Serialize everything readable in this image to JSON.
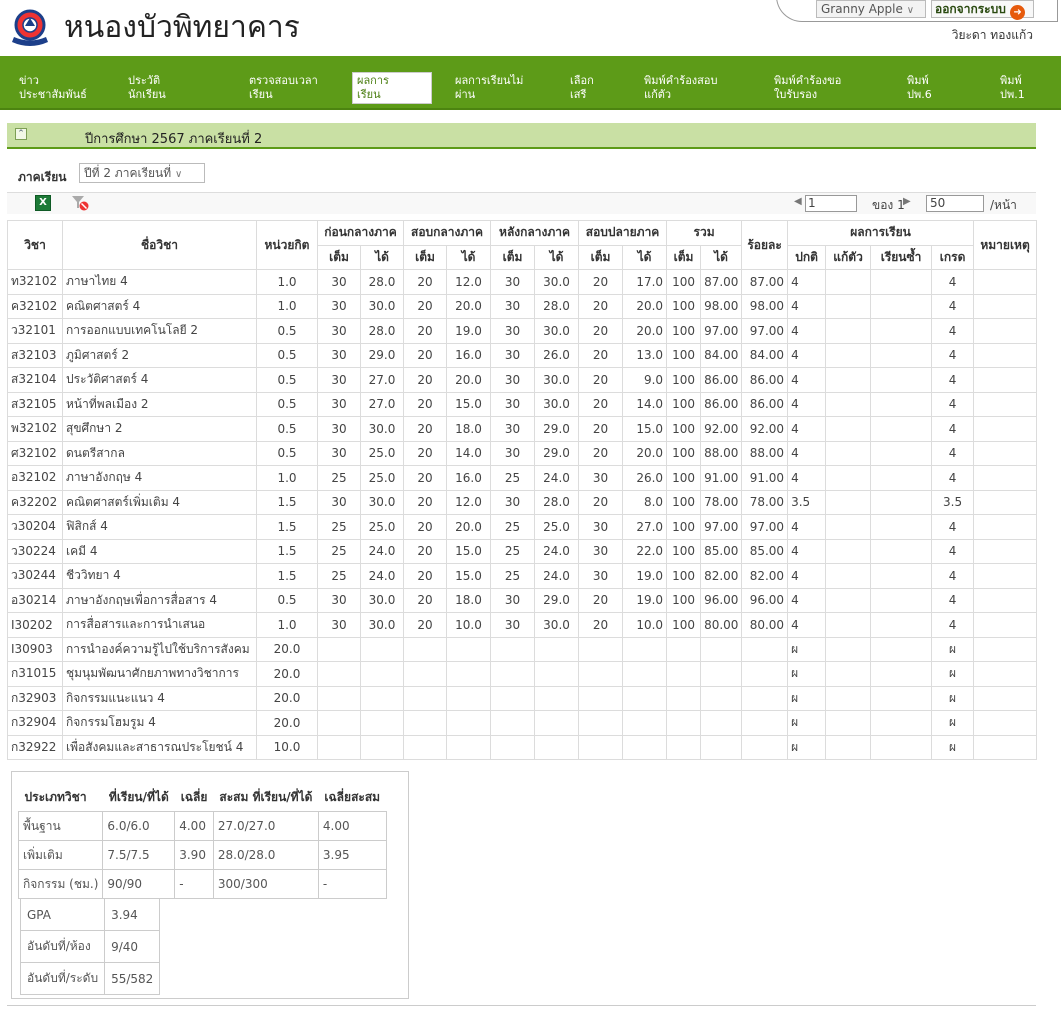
{
  "header": {
    "school_name": "หนองบัวพิทยาคาร",
    "theme_value": "Granny Apple",
    "logout_label": "ออกจากระบบ",
    "user_name": "วิยะดา ทองแก้ว"
  },
  "nav": {
    "items": [
      "ข่าว\nประชาสัมพันธ์",
      "ประวัติ\nนักเรียน",
      "ตรวจสอบเวลา\nเรียน",
      "ผลการ\nเรียน",
      "ผลการเรียนไม่\nผ่าน",
      "เลือก\nเสรี",
      "พิมพ์คำร้องสอบ\nแก้ตัว",
      "พิมพ์คำร้องขอ\nใบรับรอง",
      "พิมพ์\nปพ.6",
      "พิมพ์\nปพ.1"
    ],
    "active_index": 3
  },
  "section": {
    "title": "ปีการศึกษา 2567 ภาคเรียนที่ 2"
  },
  "filter": {
    "semester_label": "ภาคเรียน",
    "semester_value": "ปีที่ 2 ภาคเรียนที่"
  },
  "pager": {
    "page": "1",
    "of_text": "ของ 1",
    "page_size": "50",
    "per_page": "/หน้า"
  },
  "table": {
    "headers": {
      "code": "วิชา",
      "name": "ชื่อวิชา",
      "credit": "หน่วยกิต",
      "pre_mid": "ก่อนกลางภาค",
      "mid": "สอบกลางภาค",
      "post_mid": "หลังกลางภาค",
      "final": "สอบปลายภาค",
      "total": "รวม",
      "percent": "ร้อยละ",
      "result": "ผลการเรียน",
      "remark": "หมายเหตุ",
      "full": "เต็ม",
      "got": "ได้",
      "normal": "ปกติ",
      "retest": "แก้ตัว",
      "repeat": "เรียนซ้ำ",
      "grade": "เกรด"
    },
    "rows": [
      [
        "ท32102",
        "ภาษาไทย 4",
        "1.0",
        "30",
        "28.0",
        "20",
        "12.0",
        "30",
        "30.0",
        "20",
        "17.0",
        "100",
        "87.00",
        "87.00",
        "4",
        "",
        "",
        "4",
        ""
      ],
      [
        "ค32102",
        "คณิตศาสตร์ 4",
        "1.0",
        "30",
        "30.0",
        "20",
        "20.0",
        "30",
        "28.0",
        "20",
        "20.0",
        "100",
        "98.00",
        "98.00",
        "4",
        "",
        "",
        "4",
        ""
      ],
      [
        "ว32101",
        "การออกแบบเทคโนโลยี 2",
        "0.5",
        "30",
        "28.0",
        "20",
        "19.0",
        "30",
        "30.0",
        "20",
        "20.0",
        "100",
        "97.00",
        "97.00",
        "4",
        "",
        "",
        "4",
        ""
      ],
      [
        "ส32103",
        "ภูมิศาสตร์ 2",
        "0.5",
        "30",
        "29.0",
        "20",
        "16.0",
        "30",
        "26.0",
        "20",
        "13.0",
        "100",
        "84.00",
        "84.00",
        "4",
        "",
        "",
        "4",
        ""
      ],
      [
        "ส32104",
        "ประวัติศาสตร์ 4",
        "0.5",
        "30",
        "27.0",
        "20",
        "20.0",
        "30",
        "30.0",
        "20",
        "9.0",
        "100",
        "86.00",
        "86.00",
        "4",
        "",
        "",
        "4",
        ""
      ],
      [
        "ส32105",
        "หน้าที่พลเมือง 2",
        "0.5",
        "30",
        "27.0",
        "20",
        "15.0",
        "30",
        "30.0",
        "20",
        "14.0",
        "100",
        "86.00",
        "86.00",
        "4",
        "",
        "",
        "4",
        ""
      ],
      [
        "พ32102",
        "สุขศึกษา 2",
        "0.5",
        "30",
        "30.0",
        "20",
        "18.0",
        "30",
        "29.0",
        "20",
        "15.0",
        "100",
        "92.00",
        "92.00",
        "4",
        "",
        "",
        "4",
        ""
      ],
      [
        "ศ32102",
        "ดนตรีสากล",
        "0.5",
        "30",
        "25.0",
        "20",
        "14.0",
        "30",
        "29.0",
        "20",
        "20.0",
        "100",
        "88.00",
        "88.00",
        "4",
        "",
        "",
        "4",
        ""
      ],
      [
        "อ32102",
        "ภาษาอังกฤษ 4",
        "1.0",
        "25",
        "25.0",
        "20",
        "16.0",
        "25",
        "24.0",
        "30",
        "26.0",
        "100",
        "91.00",
        "91.00",
        "4",
        "",
        "",
        "4",
        ""
      ],
      [
        "ค32202",
        "คณิตศาสตร์เพิ่มเติม 4",
        "1.5",
        "30",
        "30.0",
        "20",
        "12.0",
        "30",
        "28.0",
        "20",
        "8.0",
        "100",
        "78.00",
        "78.00",
        "3.5",
        "",
        "",
        "3.5",
        ""
      ],
      [
        "ว30204",
        "ฟิสิกส์ 4",
        "1.5",
        "25",
        "25.0",
        "20",
        "20.0",
        "25",
        "25.0",
        "30",
        "27.0",
        "100",
        "97.00",
        "97.00",
        "4",
        "",
        "",
        "4",
        ""
      ],
      [
        "ว30224",
        "เคมี 4",
        "1.5",
        "25",
        "24.0",
        "20",
        "15.0",
        "25",
        "24.0",
        "30",
        "22.0",
        "100",
        "85.00",
        "85.00",
        "4",
        "",
        "",
        "4",
        ""
      ],
      [
        "ว30244",
        "ชีววิทยา 4",
        "1.5",
        "25",
        "24.0",
        "20",
        "15.0",
        "25",
        "24.0",
        "30",
        "19.0",
        "100",
        "82.00",
        "82.00",
        "4",
        "",
        "",
        "4",
        ""
      ],
      [
        "อ30214",
        "ภาษาอังกฤษเพื่อการสื่อสาร 4",
        "0.5",
        "30",
        "30.0",
        "20",
        "18.0",
        "30",
        "29.0",
        "20",
        "19.0",
        "100",
        "96.00",
        "96.00",
        "4",
        "",
        "",
        "4",
        ""
      ],
      [
        "I30202",
        "การสื่อสารและการนำเสนอ",
        "1.0",
        "30",
        "30.0",
        "20",
        "10.0",
        "30",
        "30.0",
        "20",
        "10.0",
        "100",
        "80.00",
        "80.00",
        "4",
        "",
        "",
        "4",
        ""
      ],
      [
        "I30903",
        "การนำองค์ความรู้ไปใช้บริการสังคม",
        "20.0",
        "",
        "",
        "",
        "",
        "",
        "",
        "",
        "",
        "",
        "",
        "",
        "ผ",
        "",
        "",
        "ผ",
        ""
      ],
      [
        "ก31015",
        "ชุมนุมพัฒนาศักยภาพทางวิชาการ",
        "20.0",
        "",
        "",
        "",
        "",
        "",
        "",
        "",
        "",
        "",
        "",
        "",
        "ผ",
        "",
        "",
        "ผ",
        ""
      ],
      [
        "ก32903",
        "กิจกรรมแนะแนว 4",
        "20.0",
        "",
        "",
        "",
        "",
        "",
        "",
        "",
        "",
        "",
        "",
        "",
        "ผ",
        "",
        "",
        "ผ",
        ""
      ],
      [
        "ก32904",
        "กิจกรรมโฮมรูม 4",
        "20.0",
        "",
        "",
        "",
        "",
        "",
        "",
        "",
        "",
        "",
        "",
        "",
        "ผ",
        "",
        "",
        "ผ",
        ""
      ],
      [
        "ก32922",
        "เพื่อสังคมและสาธารณประโยชน์ 4",
        "10.0",
        "",
        "",
        "",
        "",
        "",
        "",
        "",
        "",
        "",
        "",
        "",
        "ผ",
        "",
        "",
        "ผ",
        ""
      ]
    ]
  },
  "summary": {
    "headers": [
      "ประเภทวิชา",
      "ที่เรียน/ที่ได้",
      "เฉลี่ย",
      "สะสม ที่เรียน/ที่ได้",
      "เฉลี่ยสะสม"
    ],
    "rows": [
      [
        "พื้นฐาน",
        "6.0/6.0",
        "4.00",
        "27.0/27.0",
        "4.00"
      ],
      [
        "เพิ่มเติม",
        "7.5/7.5",
        "3.90",
        "28.0/28.0",
        "3.95"
      ],
      [
        "กิจกรรม (ชม.)",
        "90/90",
        "-",
        "300/300",
        "-"
      ]
    ],
    "gpa": [
      [
        "GPA",
        "3.94"
      ],
      [
        "อันดับที่/ห้อง",
        "9/40"
      ],
      [
        "อันดับที่/ระดับ",
        "55/582"
      ]
    ]
  },
  "icons": {
    "logo": "school-emblem-icon",
    "logout": "arrow-right-circle-icon",
    "collapse": "collapse-up-icon",
    "excel": "excel-export-icon",
    "filter": "clear-filter-icon",
    "prev": "triangle-left-icon",
    "next": "triangle-right-icon"
  },
  "colors": {
    "nav_bg": "#5d9b18",
    "section_bg": "#c9e0a4",
    "logout_icon": "#e65a0c"
  }
}
